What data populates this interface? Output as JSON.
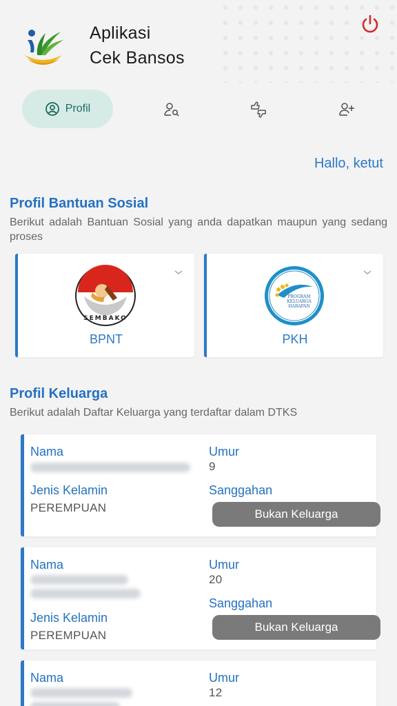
{
  "header": {
    "title_line1": "Aplikasi",
    "title_line2": "Cek Bansos"
  },
  "tabs": [
    {
      "label": "Profil",
      "icon": "user-circle-icon",
      "active": true
    },
    {
      "label": "",
      "icon": "user-search-icon",
      "active": false
    },
    {
      "label": "",
      "icon": "thumbs-swap-icon",
      "active": false
    },
    {
      "label": "",
      "icon": "user-add-icon",
      "active": false
    }
  ],
  "greeting": "Hallo, ketut",
  "bansos": {
    "title": "Profil Bantuan Sosial",
    "description": "Berikut adalah Bantuan Sosial yang anda dapatkan maupun yang sedang proses",
    "programs": [
      {
        "name": "BPNT",
        "logo": "sembako-logo",
        "logo_text": "SEMBAKO"
      },
      {
        "name": "PKH",
        "logo": "pkh-logo",
        "logo_text": "PROGRAM KELUARGA HARAPAN"
      }
    ]
  },
  "keluarga": {
    "title": "Profil Keluarga",
    "description": "Berikut adalah Daftar Keluarga yang terdaftar dalam DTKS",
    "labels": {
      "nama": "Nama",
      "umur": "Umur",
      "jenis_kelamin": "Jenis Kelamin",
      "sanggahan": "Sanggahan"
    },
    "members": [
      {
        "umur": "9",
        "jenis_kelamin": "PEREMPUAN",
        "button": "Bukan Keluarga"
      },
      {
        "umur": "20",
        "jenis_kelamin": "PEREMPUAN",
        "button": "Bukan Keluarga"
      },
      {
        "umur": "12"
      }
    ]
  },
  "colors": {
    "accent": "#2c79c4",
    "active_tab_bg": "#d6ebe6",
    "power": "#d42a2a",
    "button": "#7a7a7a"
  }
}
